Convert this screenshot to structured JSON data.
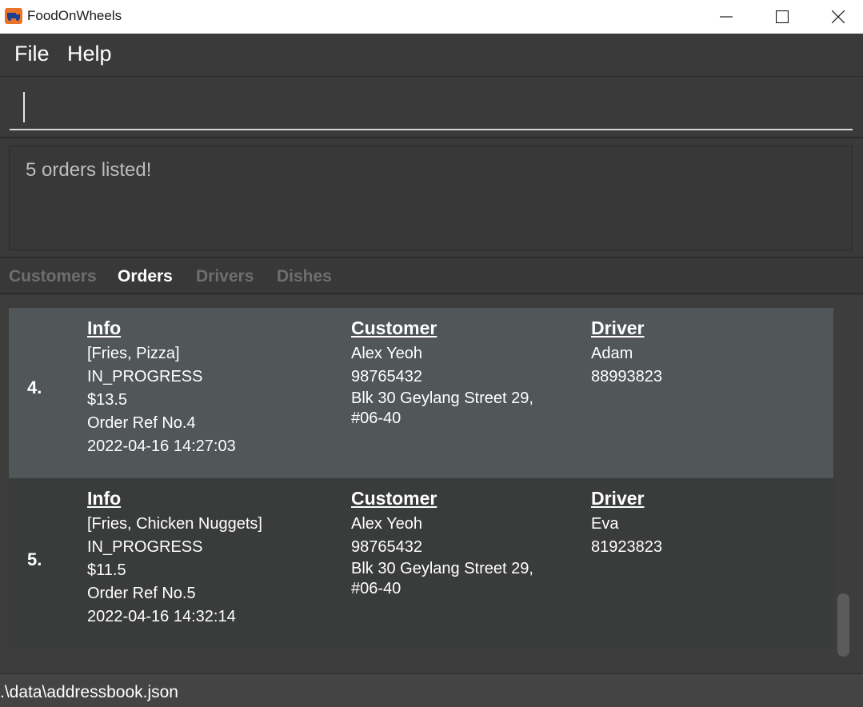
{
  "window": {
    "title": "FoodOnWheels",
    "icon": "truck-icon"
  },
  "menu": {
    "file": "File",
    "help": "Help"
  },
  "command": {
    "value": "",
    "placeholder": ""
  },
  "result": {
    "message": "5 orders listed!"
  },
  "tabs": [
    {
      "label": "Customers",
      "active": false
    },
    {
      "label": "Orders",
      "active": true
    },
    {
      "label": "Drivers",
      "active": false
    },
    {
      "label": "Dishes",
      "active": false
    }
  ],
  "orders": [
    {
      "index": "4.",
      "info_header": "Info",
      "dishes": "[Fries, Pizza]",
      "status": "IN_PROGRESS",
      "price": "$13.5",
      "ref": "Order Ref No.4",
      "datetime": "2022-04-16 14:27:03",
      "customer_header": "Customer",
      "customer_name": "Alex Yeoh",
      "customer_phone": "98765432",
      "customer_address_1": "Blk 30 Geylang Street 29,",
      "customer_address_2": "#06-40",
      "driver_header": "Driver",
      "driver_name": "Adam",
      "driver_phone": "88993823"
    },
    {
      "index": "5.",
      "info_header": "Info",
      "dishes": "[Fries, Chicken Nuggets]",
      "status": "IN_PROGRESS",
      "price": "$11.5",
      "ref": "Order Ref No.5",
      "datetime": "2022-04-16 14:32:14",
      "customer_header": "Customer",
      "customer_name": "Alex Yeoh",
      "customer_phone": "98765432",
      "customer_address_1": "Blk 30 Geylang Street 29,",
      "customer_address_2": "#06-40",
      "driver_header": "Driver",
      "driver_name": "Eva",
      "driver_phone": "81923823"
    }
  ],
  "status_bar": {
    "path": ".\\data\\addressbook.json"
  },
  "colors": {
    "accent": "#e8742a",
    "selected_row": "#515658",
    "background": "#3b3b3b"
  }
}
